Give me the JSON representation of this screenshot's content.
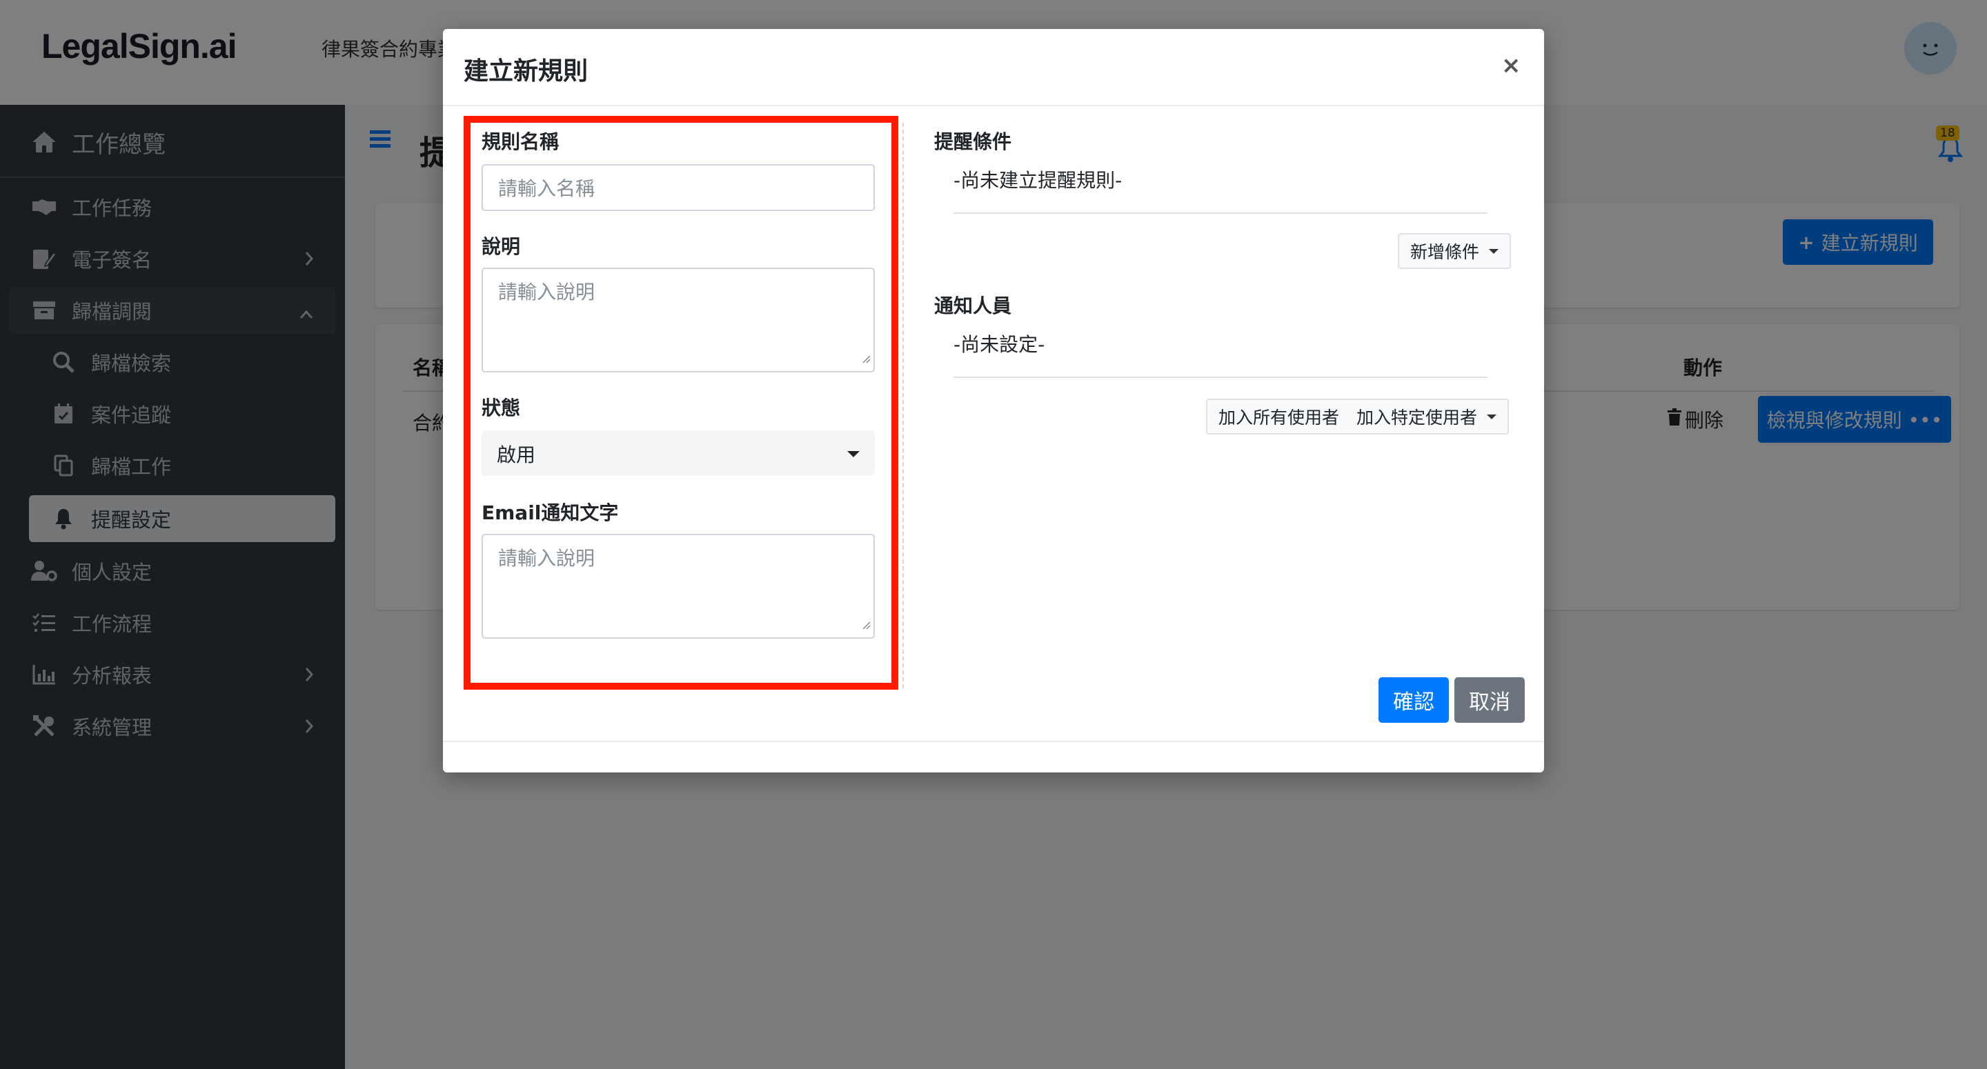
{
  "header": {
    "logo": "LegalSign.ai",
    "company": "律果簽合約專業",
    "avatar_icon": "smiley-avatar-icon"
  },
  "sidebar": {
    "dashboard": "工作總覽",
    "items": [
      {
        "label": "工作任務",
        "icon": "handshake-icon"
      },
      {
        "label": "電子簽名",
        "icon": "signature-icon"
      },
      {
        "label": "歸檔調閱",
        "icon": "archive-icon"
      },
      {
        "label": "歸檔檢索",
        "icon": "search-icon"
      },
      {
        "label": "案件追蹤",
        "icon": "calendar-check-icon"
      },
      {
        "label": "歸檔工作",
        "icon": "copy-icon"
      },
      {
        "label": "提醒設定",
        "icon": "bell-icon"
      },
      {
        "label": "個人設定",
        "icon": "user-cog-icon"
      },
      {
        "label": "工作流程",
        "icon": "tasks-icon"
      },
      {
        "label": "分析報表",
        "icon": "chart-icon"
      },
      {
        "label": "系統管理",
        "icon": "tools-icon"
      }
    ]
  },
  "main": {
    "page_title": "提",
    "notification_count": "18",
    "create_button": "建立新規則",
    "table": {
      "col_name": "名稱",
      "col_action": "動作",
      "row_name": "合約",
      "delete_label": "刪除",
      "view_label": "檢視與修改規則 •••"
    }
  },
  "modal": {
    "title": "建立新規則",
    "close": "×",
    "left": {
      "name_label": "規則名稱",
      "name_placeholder": "請輸入名稱",
      "desc_label": "說明",
      "desc_placeholder": "請輸入說明",
      "status_label": "狀態",
      "status_value": "啟用",
      "email_label": "Email通知文字",
      "email_placeholder": "請輸入說明"
    },
    "right": {
      "condition_label": "提醒條件",
      "condition_empty": "-尚未建立提醒規則-",
      "add_condition": "新增條件",
      "notify_label": "通知人員",
      "notify_empty": "-尚未設定-",
      "add_all_users": "加入所有使用者",
      "add_specific_users": "加入特定使用者"
    },
    "confirm": "確認",
    "cancel": "取消"
  },
  "colors": {
    "primary": "#007bff",
    "sidebar_bg": "#343a40",
    "highlight": "#ff1a00",
    "secondary": "#6c757d"
  }
}
